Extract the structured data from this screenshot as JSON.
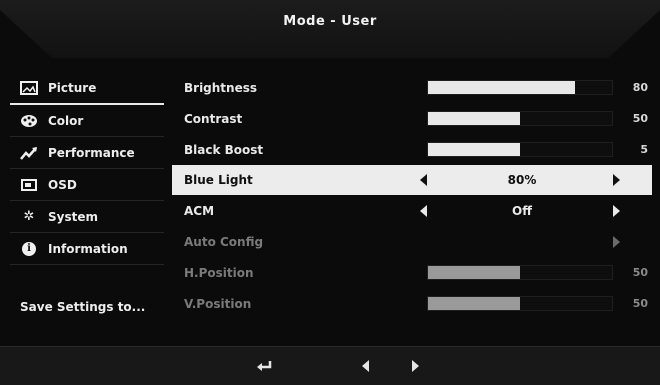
{
  "header": {
    "title": "Mode - User"
  },
  "sidebar": {
    "items": [
      {
        "label": "Picture",
        "icon": "picture-icon",
        "active": true
      },
      {
        "label": "Color",
        "icon": "palette-icon"
      },
      {
        "label": "Performance",
        "icon": "performance-icon"
      },
      {
        "label": "OSD",
        "icon": "osd-icon"
      },
      {
        "label": "System",
        "icon": "gear-icon"
      },
      {
        "label": "Information",
        "icon": "info-icon"
      }
    ],
    "save_label": "Save Settings to..."
  },
  "settings": {
    "brightness": {
      "label": "Brightness",
      "value": "80",
      "level": 0.8
    },
    "contrast": {
      "label": "Contrast",
      "value": "50",
      "level": 0.5
    },
    "black_boost": {
      "label": "Black Boost",
      "value": "5",
      "level": 0.5
    },
    "blue_light": {
      "label": "Blue Light",
      "value": "80%"
    },
    "acm": {
      "label": "ACM",
      "value": "Off"
    },
    "auto_config": {
      "label": "Auto Config"
    },
    "h_position": {
      "label": "H.Position",
      "value": "50",
      "level": 0.5
    },
    "v_position": {
      "label": "V.Position",
      "value": "50",
      "level": 0.5
    }
  },
  "footer": {
    "buttons": [
      "return-icon",
      "left-arrow-icon",
      "right-arrow-icon"
    ]
  },
  "colors": {
    "background": "#0b0b0b",
    "highlight": "#ececec",
    "bar_fill": "#e8e8e8",
    "disabled": "#7a7a7a"
  }
}
